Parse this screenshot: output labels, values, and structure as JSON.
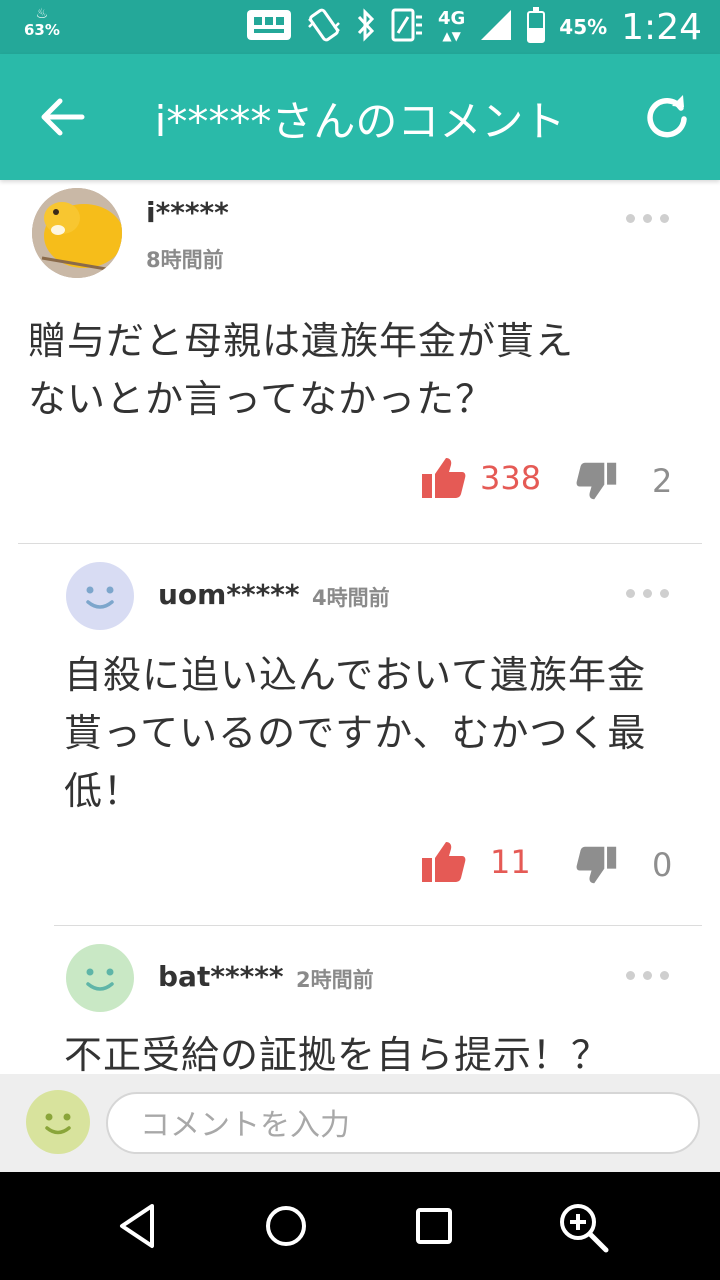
{
  "status_bar": {
    "left_indicator": "63%",
    "network": "4G",
    "battery_percent": "45%",
    "battery_level": 0.45,
    "time": "1:24"
  },
  "app_bar": {
    "title": "i*****さんのコメント",
    "back_icon": "arrow-left-icon",
    "reload_icon": "refresh-icon",
    "color": "#2abaa9"
  },
  "comments": [
    {
      "user": "i*****",
      "time": "8時間前",
      "text_lines": [
        "贈与だと母親は遺族年金が貰え",
        "ないとか言ってなかった？"
      ],
      "likes": "338",
      "dislikes": "2"
    },
    {
      "user": "uom*****",
      "time": "4時間前",
      "text_lines": [
        "自殺に追い込んでおいて遺族年金",
        "貰っているのですか、むかつく最",
        "低！"
      ],
      "likes": "11",
      "dislikes": "0"
    },
    {
      "user": "bat*****",
      "time": "2時間前",
      "text_lines": [
        "不正受給の証拠を自ら提示！？"
      ]
    }
  ],
  "input_bar": {
    "placeholder": "コメントを入力"
  },
  "nav_bar": {
    "buttons": [
      "back-triangle-icon",
      "home-circle-icon",
      "recents-square-icon",
      "zoom-icon"
    ]
  },
  "colors": {
    "like": "#e55a55",
    "dislike": "#8e8e8e",
    "status_bar": "#24a899"
  }
}
